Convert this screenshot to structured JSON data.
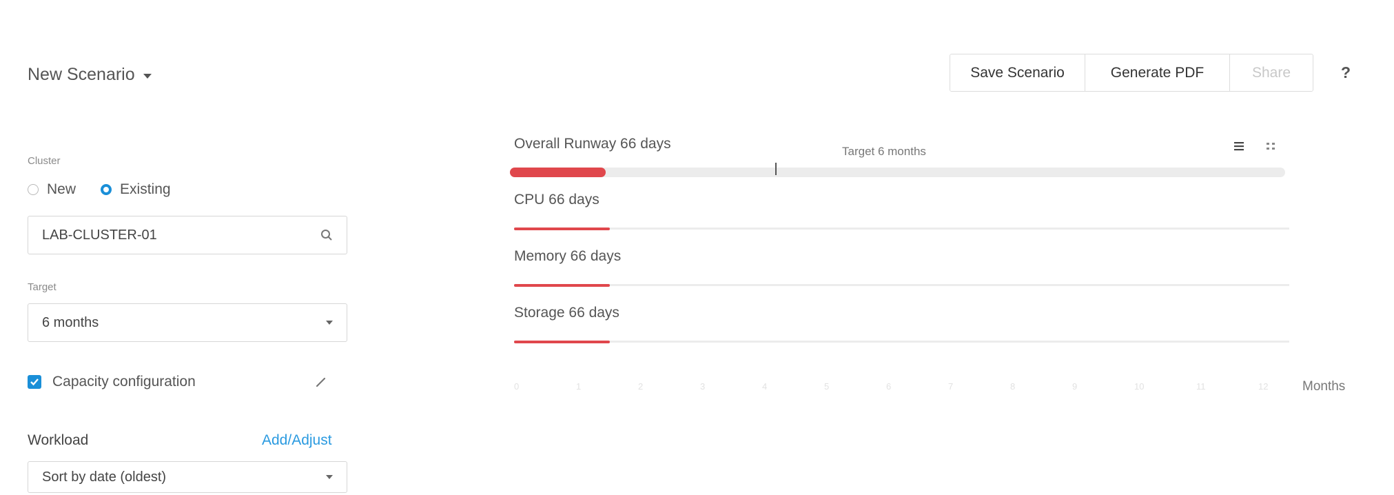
{
  "header": {
    "scenario_title": "New Scenario",
    "actions": {
      "save": "Save Scenario",
      "pdf": "Generate PDF",
      "share": "Share"
    },
    "help": "?"
  },
  "left_panel": {
    "cluster_label": "Cluster",
    "cluster_options": {
      "new": "New",
      "existing": "Existing",
      "selected": "Existing"
    },
    "cluster_value": "LAB-CLUSTER-01",
    "target_label": "Target",
    "target_value": "6 months",
    "capacity_label": "Capacity configuration",
    "capacity_checked": true,
    "workload_label": "Workload",
    "add_adjust": "Add/Adjust",
    "sort_value": "Sort by date (oldest)"
  },
  "runway": {
    "target_label": "Target 6 months",
    "target_months": 6,
    "rows": [
      {
        "label": "Overall Runway 66 days",
        "days": 66
      },
      {
        "label": "CPU 66 days",
        "days": 66
      },
      {
        "label": "Memory 66 days",
        "days": 66
      },
      {
        "label": "Storage 66 days",
        "days": 66
      }
    ],
    "axis_ticks": [
      "0",
      "1",
      "2",
      "3",
      "4",
      "5",
      "6",
      "7",
      "8",
      "9",
      "10",
      "11",
      "12"
    ],
    "axis_unit": "Months",
    "axis_max_months": 12
  },
  "colors": {
    "accent": "#1a8fd8",
    "bar": "#e0474c",
    "track": "#ececec",
    "link": "#2a9ae0"
  },
  "icons": [
    "caret-down-icon",
    "search-icon",
    "chevron-down-icon",
    "checkbox-checked-icon",
    "pencil-icon",
    "list-view-icon",
    "grid-view-icon",
    "help-icon"
  ]
}
